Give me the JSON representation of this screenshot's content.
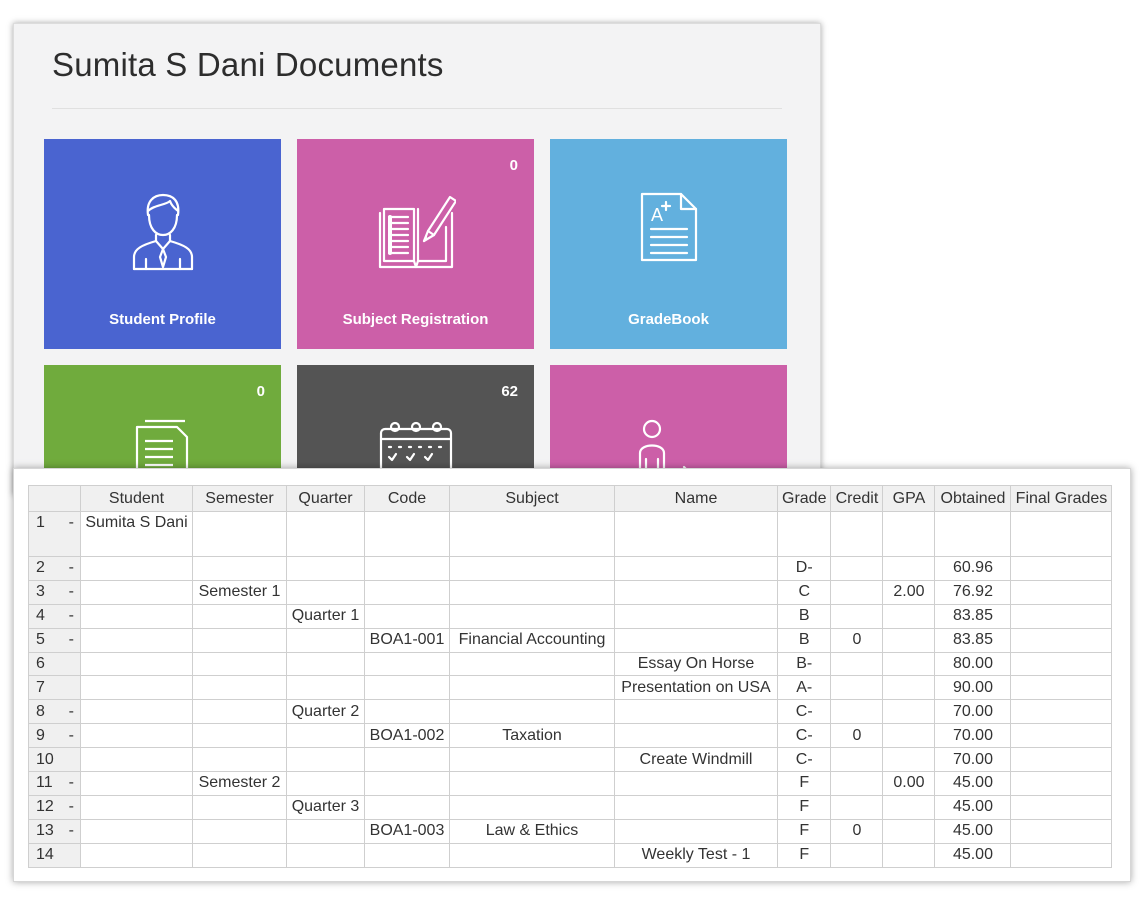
{
  "documents": {
    "title": "Sumita S Dani Documents",
    "tiles": [
      {
        "label": "Student Profile",
        "badge": "",
        "icon": "student-profile-icon",
        "color": "#4a64d0"
      },
      {
        "label": "Subject Registration",
        "badge": "0",
        "icon": "subject-registration-icon",
        "color": "#cc5fa8"
      },
      {
        "label": "GradeBook",
        "badge": "",
        "icon": "gradebook-icon",
        "color": "#62b0de"
      },
      {
        "label": "",
        "badge": "0",
        "icon": "documents-icon",
        "color": "#70ab3d"
      },
      {
        "label": "",
        "badge": "62",
        "icon": "calendar-icon",
        "color": "#545454"
      },
      {
        "label": "",
        "badge": "",
        "icon": "teacher-icon",
        "color": "#cc5fa8"
      }
    ]
  },
  "grades": {
    "columns": [
      "",
      "Student",
      "Semester",
      "Quarter",
      "Code",
      "Subject",
      "Name",
      "Grade",
      "Credit",
      "GPA",
      "Obtained",
      "Final Grades"
    ],
    "rows": [
      {
        "num": "1",
        "dash": "-",
        "student": "Sumita S Dani",
        "semester": "",
        "quarter": "",
        "code": "",
        "subject": "",
        "name": "",
        "grade": "",
        "credit": "",
        "gpa": "",
        "obtained": "",
        "final": ""
      },
      {
        "num": "2",
        "dash": "-",
        "student": "",
        "semester": "",
        "quarter": "",
        "code": "",
        "subject": "",
        "name": "",
        "grade": "D-",
        "credit": "",
        "gpa": "",
        "obtained": "60.96",
        "final": ""
      },
      {
        "num": "3",
        "dash": "-",
        "student": "",
        "semester": "Semester 1",
        "quarter": "",
        "code": "",
        "subject": "",
        "name": "",
        "grade": "C",
        "credit": "",
        "gpa": "2.00",
        "obtained": "76.92",
        "final": ""
      },
      {
        "num": "4",
        "dash": "-",
        "student": "",
        "semester": "",
        "quarter": "Quarter 1",
        "code": "",
        "subject": "",
        "name": "",
        "grade": "B",
        "credit": "",
        "gpa": "",
        "obtained": "83.85",
        "final": ""
      },
      {
        "num": "5",
        "dash": "-",
        "student": "",
        "semester": "",
        "quarter": "",
        "code": "BOA1-001",
        "subject": "Financial Accounting",
        "name": "",
        "grade": "B",
        "credit": "0",
        "gpa": "",
        "obtained": "83.85",
        "final": ""
      },
      {
        "num": "6",
        "dash": "",
        "student": "",
        "semester": "",
        "quarter": "",
        "code": "",
        "subject": "",
        "name": "Essay On Horse",
        "grade": "B-",
        "credit": "",
        "gpa": "",
        "obtained": "80.00",
        "final": ""
      },
      {
        "num": "7",
        "dash": "",
        "student": "",
        "semester": "",
        "quarter": "",
        "code": "",
        "subject": "",
        "name": "Presentation on USA",
        "grade": "A-",
        "credit": "",
        "gpa": "",
        "obtained": "90.00",
        "final": ""
      },
      {
        "num": "8",
        "dash": "-",
        "student": "",
        "semester": "",
        "quarter": "Quarter 2",
        "code": "",
        "subject": "",
        "name": "",
        "grade": "C-",
        "credit": "",
        "gpa": "",
        "obtained": "70.00",
        "final": ""
      },
      {
        "num": "9",
        "dash": "-",
        "student": "",
        "semester": "",
        "quarter": "",
        "code": "BOA1-002",
        "subject": "Taxation",
        "name": "",
        "grade": "C-",
        "credit": "0",
        "gpa": "",
        "obtained": "70.00",
        "final": ""
      },
      {
        "num": "10",
        "dash": "",
        "student": "",
        "semester": "",
        "quarter": "",
        "code": "",
        "subject": "",
        "name": "Create Windmill",
        "grade": "C-",
        "credit": "",
        "gpa": "",
        "obtained": "70.00",
        "final": ""
      },
      {
        "num": "11",
        "dash": "-",
        "student": "",
        "semester": "Semester 2",
        "quarter": "",
        "code": "",
        "subject": "",
        "name": "",
        "grade": "F",
        "credit": "",
        "gpa": "0.00",
        "obtained": "45.00",
        "final": ""
      },
      {
        "num": "12",
        "dash": "-",
        "student": "",
        "semester": "",
        "quarter": "Quarter 3",
        "code": "",
        "subject": "",
        "name": "",
        "grade": "F",
        "credit": "",
        "gpa": "",
        "obtained": "45.00",
        "final": ""
      },
      {
        "num": "13",
        "dash": "-",
        "student": "",
        "semester": "",
        "quarter": "",
        "code": "BOA1-003",
        "subject": "Law & Ethics",
        "name": "",
        "grade": "F",
        "credit": "0",
        "gpa": "",
        "obtained": "45.00",
        "final": ""
      },
      {
        "num": "14",
        "dash": "",
        "student": "",
        "semester": "",
        "quarter": "",
        "code": "",
        "subject": "",
        "name": "Weekly Test - 1",
        "grade": "F",
        "credit": "",
        "gpa": "",
        "obtained": "45.00",
        "final": ""
      }
    ]
  }
}
